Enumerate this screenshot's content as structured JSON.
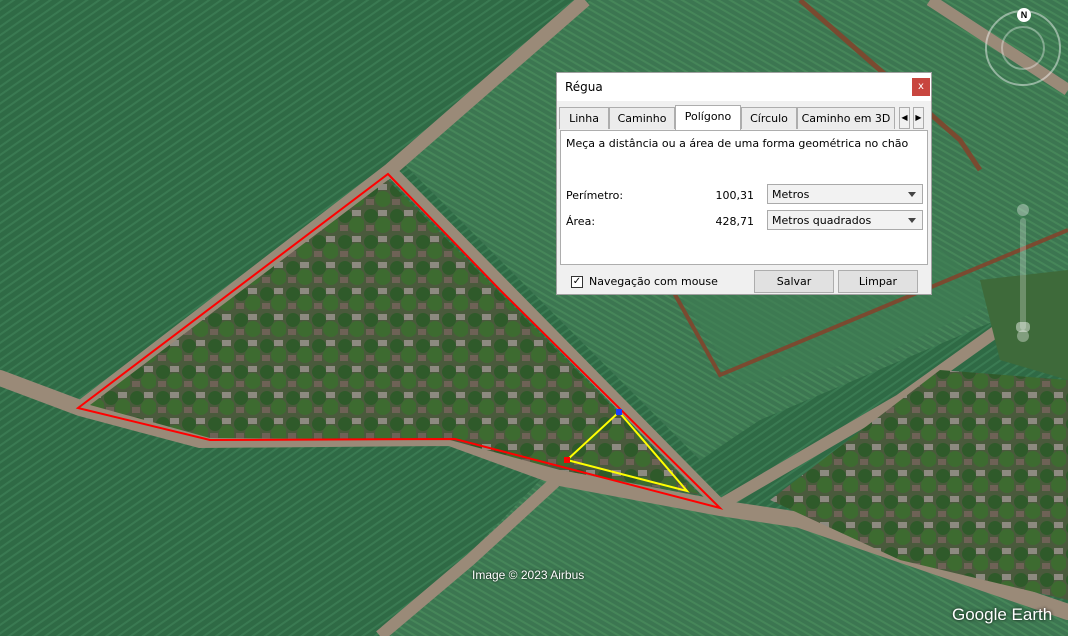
{
  "map": {
    "copyright": "Image © 2023 Airbus",
    "brand": "Google Earth",
    "compass_label": "N"
  },
  "dialog": {
    "title": "Régua",
    "close_label": "x",
    "tabs": [
      {
        "label": "Linha"
      },
      {
        "label": "Caminho"
      },
      {
        "label": "Polígono"
      },
      {
        "label": "Círculo"
      },
      {
        "label": "Caminho em 3D"
      }
    ],
    "active_tab": "Polígono",
    "description": "Meça a distância ou a área de uma forma geométrica no chão",
    "perimeter": {
      "label": "Perímetro:",
      "value": "100,31",
      "unit": "Metros"
    },
    "area": {
      "label": "Área:",
      "value": "428,71",
      "unit": "Metros quadrados"
    },
    "mouse_nav": {
      "label": "Navegação com mouse",
      "checked": true
    },
    "save_label": "Salvar",
    "clear_label": "Limpar"
  },
  "colors": {
    "outline": "#ff0000",
    "measure_polygon": "#ffff00",
    "vertex_red": "#ff0000",
    "vertex_blue": "#1a3cff"
  }
}
